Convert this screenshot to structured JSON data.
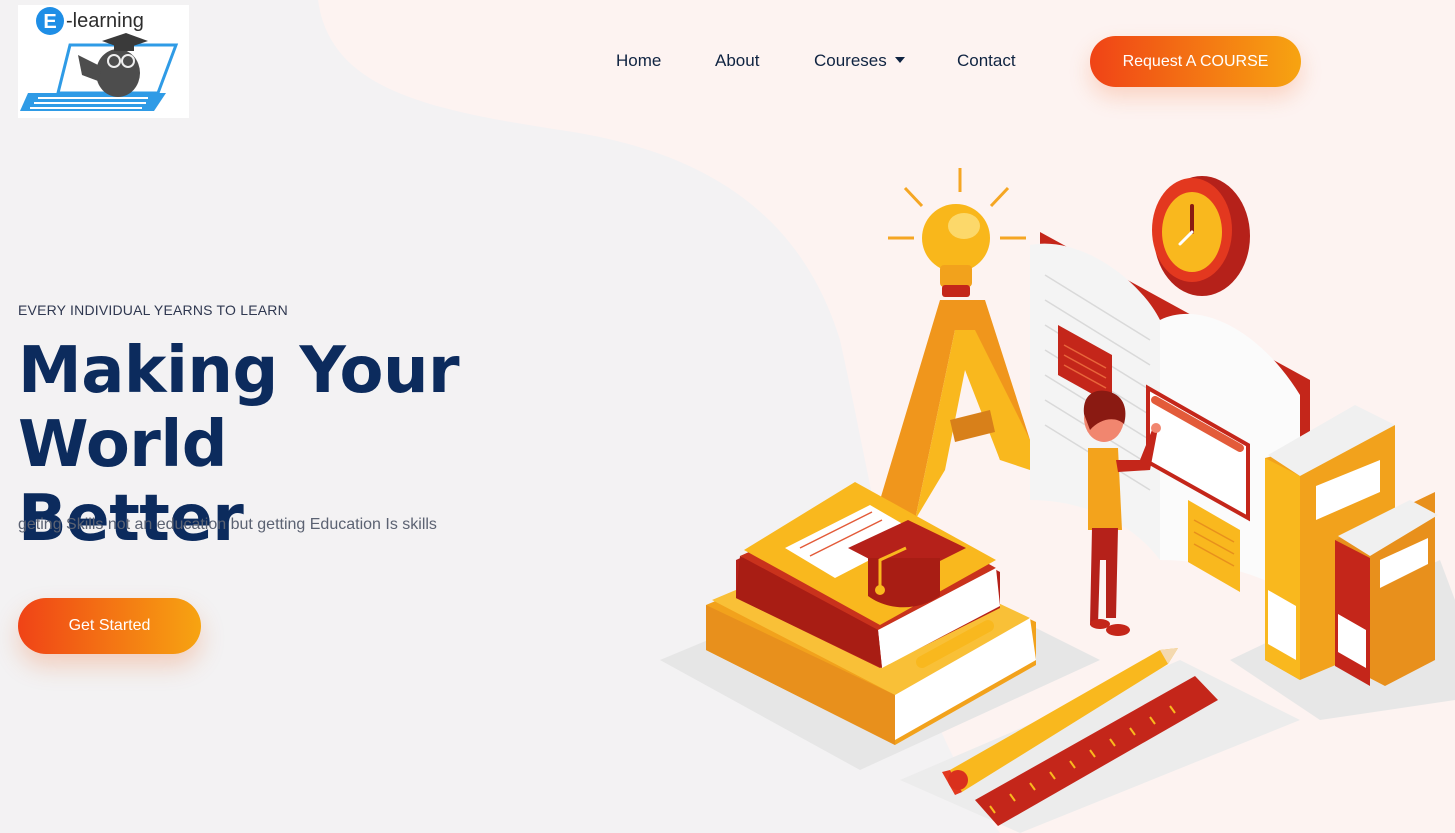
{
  "logo": {
    "text_e": "E",
    "text_rest": "-learning"
  },
  "nav": {
    "items": [
      {
        "label": "Home"
      },
      {
        "label": "About"
      },
      {
        "label": "Coureses"
      },
      {
        "label": "Contact"
      }
    ],
    "cta_label": "Request A COURSE"
  },
  "hero": {
    "eyebrow": "EVERY INDIVIDUAL YEARNS TO LEARN",
    "headline_line1": "Making Your World",
    "headline_line2": "Better",
    "subtext": "geting Skills not an education but getting Education Is skills",
    "cta_label": "Get Started"
  },
  "colors": {
    "accent_start": "#f04316",
    "accent_end": "#f7a411",
    "heading": "#0c2b5d",
    "blob": "#fdf2f0"
  }
}
